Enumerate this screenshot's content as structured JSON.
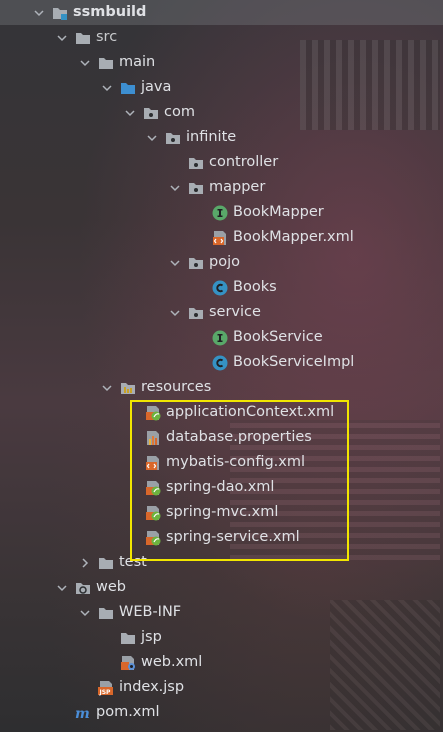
{
  "tree": [
    {
      "label": "ssmbuild",
      "icon": "module-folder-icon",
      "expanded": true
    },
    {
      "label": "src",
      "icon": "folder-icon",
      "expanded": true
    },
    {
      "label": "main",
      "icon": "folder-icon",
      "expanded": true
    },
    {
      "label": "java",
      "icon": "source-folder-icon",
      "expanded": true
    },
    {
      "label": "com",
      "icon": "package-icon",
      "expanded": true
    },
    {
      "label": "infinite",
      "icon": "package-icon",
      "expanded": true
    },
    {
      "label": "controller",
      "icon": "package-icon"
    },
    {
      "label": "mapper",
      "icon": "package-icon",
      "expanded": true
    },
    {
      "label": "BookMapper",
      "icon": "interface-icon"
    },
    {
      "label": "BookMapper.xml",
      "icon": "xml-file-icon"
    },
    {
      "label": "pojo",
      "icon": "package-icon",
      "expanded": true
    },
    {
      "label": "Books",
      "icon": "class-icon"
    },
    {
      "label": "service",
      "icon": "package-icon",
      "expanded": true
    },
    {
      "label": "BookService",
      "icon": "interface-icon"
    },
    {
      "label": "BookServiceImpl",
      "icon": "class-icon"
    },
    {
      "label": "resources",
      "icon": "resources-folder-icon",
      "expanded": true
    },
    {
      "label": "applicationContext.xml",
      "icon": "spring-xml-icon"
    },
    {
      "label": "database.properties",
      "icon": "properties-file-icon"
    },
    {
      "label": "mybatis-config.xml",
      "icon": "xml-file-icon"
    },
    {
      "label": "spring-dao.xml",
      "icon": "spring-xml-icon"
    },
    {
      "label": "spring-mvc.xml",
      "icon": "spring-xml-icon"
    },
    {
      "label": "spring-service.xml",
      "icon": "spring-xml-icon"
    },
    {
      "label": "test",
      "icon": "folder-icon",
      "expanded": false
    },
    {
      "label": "web",
      "icon": "web-folder-icon",
      "expanded": true
    },
    {
      "label": "WEB-INF",
      "icon": "folder-icon",
      "expanded": true
    },
    {
      "label": "jsp",
      "icon": "folder-icon"
    },
    {
      "label": "web.xml",
      "icon": "web-xml-icon"
    },
    {
      "label": "index.jsp",
      "icon": "jsp-file-icon"
    },
    {
      "label": "pom.xml",
      "icon": "maven-icon"
    }
  ],
  "colors": {
    "highlight_border": "#f2e600",
    "text": "#dfe1e5",
    "interface_badge": "#59a869",
    "class_badge": "#3592c4",
    "spring_leaf": "#6db33f",
    "xml_orange": "#d9672a"
  }
}
